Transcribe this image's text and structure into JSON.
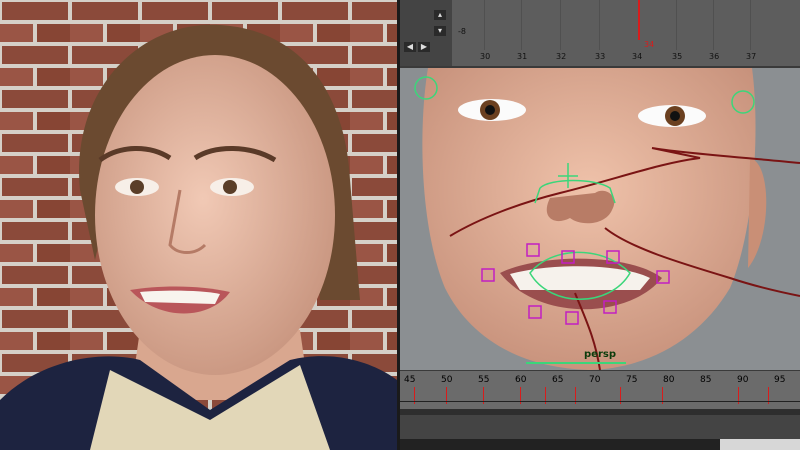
{
  "graph_editor": {
    "y_tick": "-8",
    "x_ticks": [
      "30",
      "31",
      "32",
      "33",
      "34",
      "35",
      "36",
      "37"
    ],
    "current_frame_label": "34",
    "nav_buttons": [
      "◀",
      "▶"
    ]
  },
  "viewport": {
    "camera_label": "persp"
  },
  "timeline": {
    "ticks": [
      "45",
      "50",
      "55",
      "60",
      "65",
      "70",
      "75",
      "80",
      "85",
      "90",
      "95"
    ]
  },
  "colors": {
    "current_frame": "#d81c1c",
    "control_curve": "#7a1414",
    "control_green": "#3bd67a",
    "control_magenta": "#c21fc2"
  }
}
